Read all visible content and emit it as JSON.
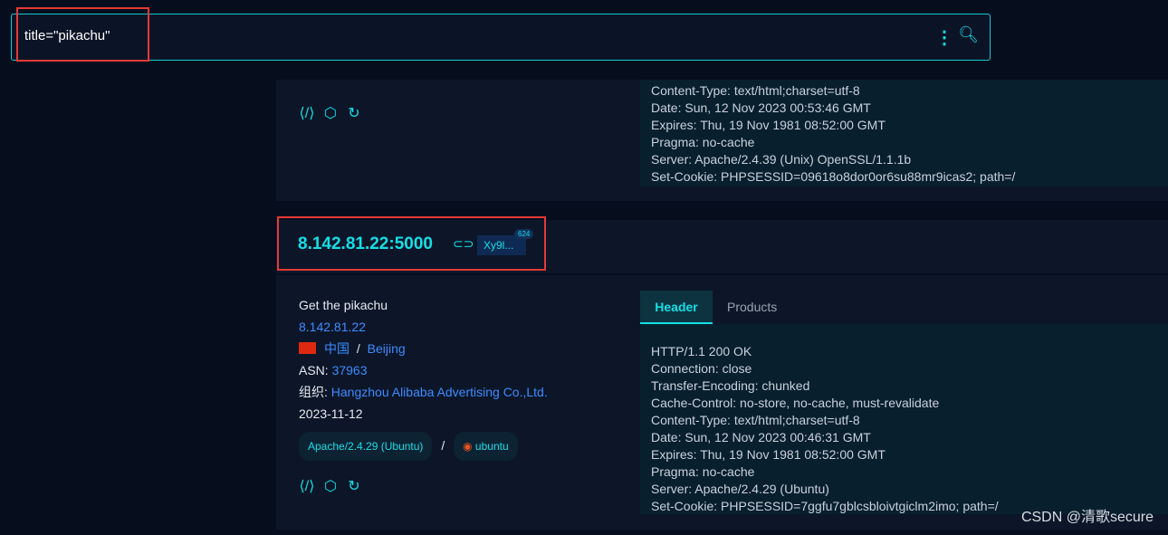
{
  "search": {
    "query": "title=\"pikachu\"",
    "more_icon": "vertical-dots-icon",
    "search_icon": "search-icon"
  },
  "card1": {
    "header_lines": [
      "Content-Type: text/html;charset=utf-8",
      "Date: Sun, 12 Nov 2023 00:53:46 GMT",
      "Expires: Thu, 19 Nov 1981 08:52:00 GMT",
      "Pragma: no-cache",
      "Server: Apache/2.4.39 (Unix) OpenSSL/1.1.1b",
      "Set-Cookie: PHPSESSID=09618o8dor0or6su88mr9icas2; path=/"
    ]
  },
  "card2": {
    "host": "8.142.81.22:5000",
    "tag": "Xy9l...",
    "tag_count": "624",
    "title": "Get the pikachu",
    "ip": "8.142.81.22",
    "country": "中国",
    "sep": "/",
    "city": "Beijing",
    "asn_label": "ASN:",
    "asn": "37963",
    "org_label": "组织:",
    "org": "Hangzhou Alibaba Advertising Co.,Ltd.",
    "date": "2023-11-12",
    "server_pill": "Apache/2.4.29 (Ubuntu)",
    "os_pill": "ubuntu",
    "tabs": [
      "Header",
      "Products"
    ],
    "header_lines": [
      "HTTP/1.1 200 OK",
      "Connection: close",
      "Transfer-Encoding: chunked",
      "Cache-Control: no-store, no-cache, must-revalidate",
      "Content-Type: text/html;charset=utf-8",
      "Date: Sun, 12 Nov 2023 00:46:31 GMT",
      "Expires: Thu, 19 Nov 1981 08:52:00 GMT",
      "Pragma: no-cache",
      "Server: Apache/2.4.29 (Ubuntu)",
      "Set-Cookie: PHPSESSID=7ggfu7gblcsbloivtgiclm2imo; path=/"
    ]
  },
  "watermark": "CSDN @清歌secure",
  "colors": {
    "accent": "#14dfe6",
    "link": "#3d8bff",
    "highlight": "#e53935"
  }
}
